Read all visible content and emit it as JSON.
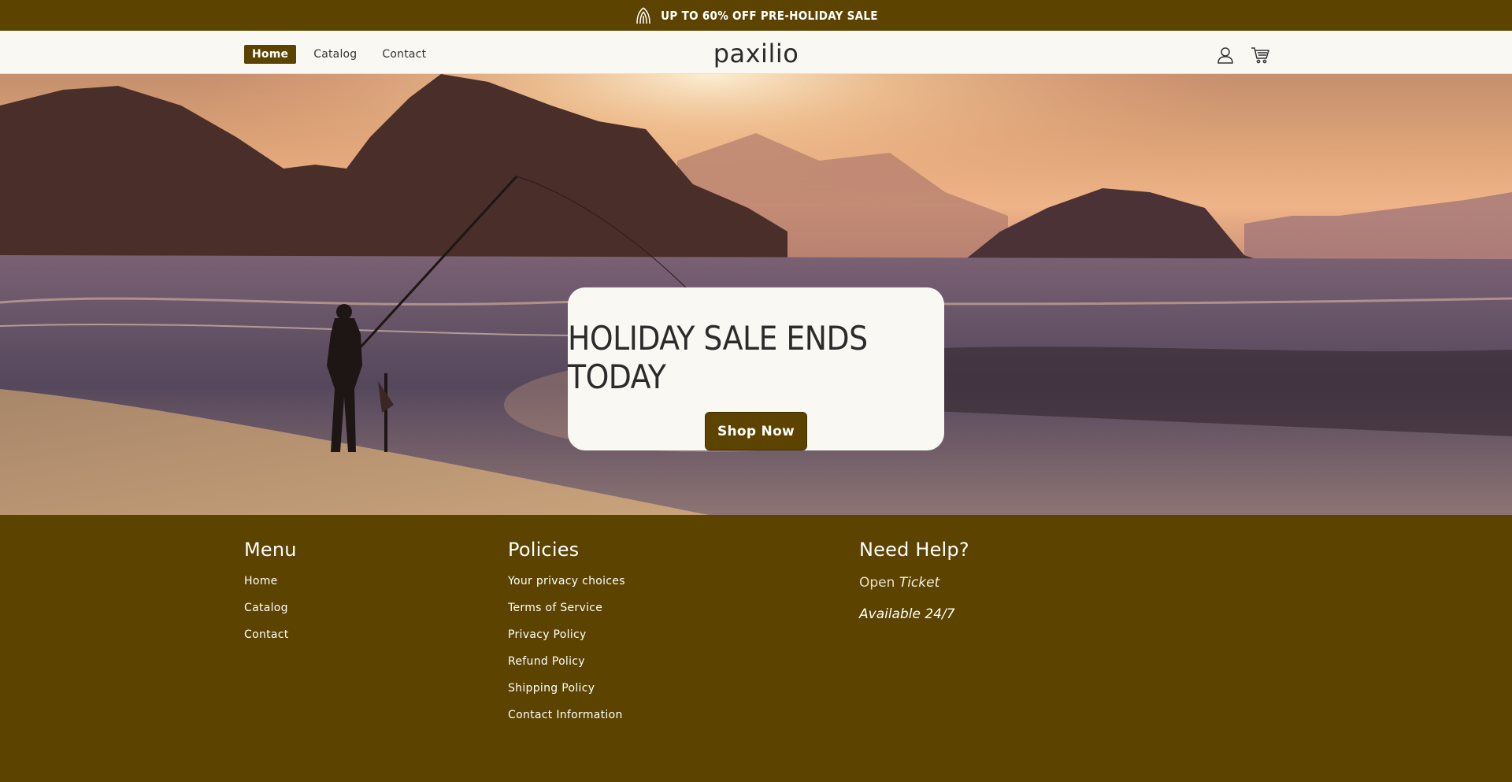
{
  "announcement": {
    "text": "UP TO 60% OFF PRE-HOLIDAY SALE",
    "icon": "leaf-badge-icon"
  },
  "header": {
    "logo": "paxilio",
    "nav": [
      {
        "label": "Home",
        "active": true
      },
      {
        "label": "Catalog",
        "active": false
      },
      {
        "label": "Contact",
        "active": false
      }
    ],
    "icons": [
      "account-icon",
      "cart-icon"
    ]
  },
  "hero": {
    "heading": "HOLIDAY SALE ENDS TODAY",
    "cta_label": "Shop Now"
  },
  "footer": {
    "menu": {
      "title": "Menu",
      "items": [
        "Home",
        "Catalog",
        "Contact"
      ]
    },
    "policies": {
      "title": "Policies",
      "items": [
        "Your privacy choices",
        "Terms of Service",
        "Privacy Policy",
        "Refund Policy",
        "Shipping Policy",
        "Contact Information"
      ]
    },
    "help": {
      "title": "Need Help?",
      "open_label": "Open",
      "ticket_label": "Ticket",
      "availability": "Available 24/7"
    }
  },
  "colors": {
    "brand": "#5c4300",
    "surface": "#faf8f3",
    "text_dark": "#2b2b2b"
  }
}
